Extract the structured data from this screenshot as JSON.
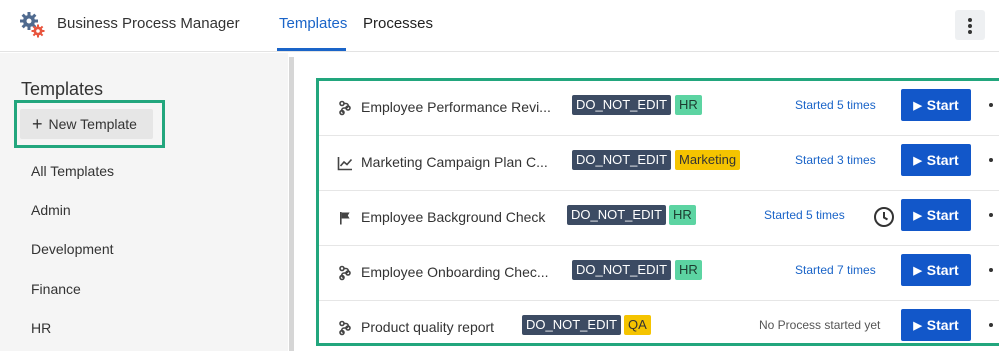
{
  "header": {
    "app_title": "Business Process Manager",
    "tabs": [
      {
        "label": "Templates",
        "active": true
      },
      {
        "label": "Processes",
        "active": false
      }
    ]
  },
  "sidebar": {
    "title": "Templates",
    "new_button": "New Template",
    "items": [
      {
        "label": "All Templates"
      },
      {
        "label": "Admin"
      },
      {
        "label": "Development"
      },
      {
        "label": "Finance"
      },
      {
        "label": "HR"
      }
    ]
  },
  "templates": [
    {
      "icon": "workflow-icon",
      "name": "Employee Performance Revi...",
      "tags": [
        "DO_NOT_EDIT",
        "HR"
      ],
      "status": "Started 5 times",
      "start": "Start"
    },
    {
      "icon": "chart-icon",
      "name": "Marketing Campaign Plan C...",
      "tags": [
        "DO_NOT_EDIT",
        "Marketing"
      ],
      "status": "Started 3 times",
      "start": "Start"
    },
    {
      "icon": "flag-icon",
      "name": "Employee Background Check",
      "tags": [
        "DO_NOT_EDIT",
        "HR"
      ],
      "status": "Started 5 times",
      "start": "Start",
      "scheduled": true
    },
    {
      "icon": "workflow-icon",
      "name": "Employee Onboarding Chec...",
      "tags": [
        "DO_NOT_EDIT",
        "HR"
      ],
      "status": "Started 7 times",
      "start": "Start"
    },
    {
      "icon": "workflow-icon",
      "name": "Product quality report",
      "tags": [
        "DO_NOT_EDIT",
        "QA"
      ],
      "status": "No Process started yet",
      "start": "Start"
    }
  ],
  "colors": {
    "accent": "#1a64c8",
    "start_button": "#1257c9",
    "highlight_frame": "#22a67d",
    "tag_dark": "#3c4b63",
    "tag_hr": "#5cd4a2",
    "tag_yellow": "#f5c400"
  }
}
